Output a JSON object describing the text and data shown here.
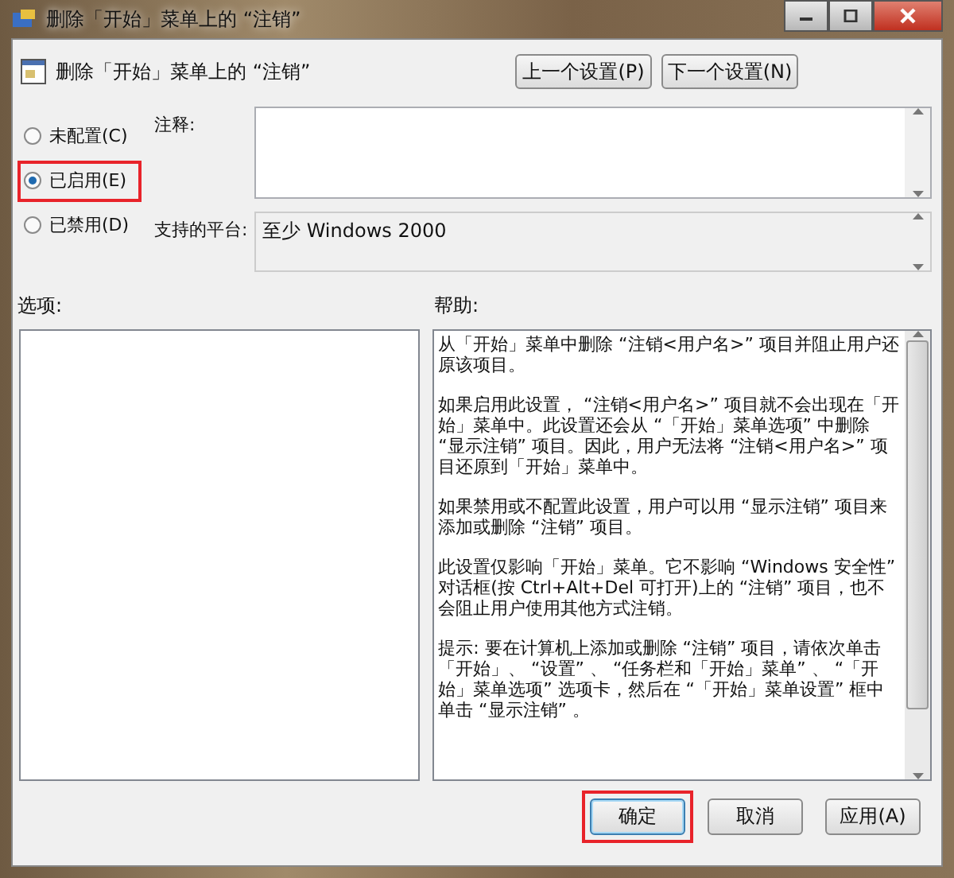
{
  "window": {
    "title": "删除「开始」菜单上的 “注销”"
  },
  "header": {
    "title": "删除「开始」菜单上的 “注销”",
    "buttons": [
      "上一个设置(P)",
      "下一个设置(N)"
    ]
  },
  "state_options": [
    {
      "label": "未配置(C)",
      "selected": false,
      "annotated": false
    },
    {
      "label": "已启用(E)",
      "selected": true,
      "annotated": true
    },
    {
      "label": "已禁用(D)",
      "selected": false,
      "annotated": false
    }
  ],
  "comment": {
    "label": "注释:"
  },
  "platform": {
    "label": "支持的平台:",
    "value": "至少 Windows 2000"
  },
  "options": {
    "label": "选项:"
  },
  "help": {
    "label": "帮助:",
    "paragraphs": [
      "从「开始」菜单中删除 “注销<用户名>” 项目并阻止用户还原该项目。",
      "如果启用此设置， “注销<用户名>” 项目就不会出现在「开始」菜单中。此设置还会从 “「开始」菜单选项” 中删除 “显示注销” 项目。因此，用户无法将 “注销<用户名>” 项目还原到「开始」菜单中。",
      "如果禁用或不配置此设置，用户可以用 “显示注销” 项目来添加或删除 “注销” 项目。",
      "此设置仅影响「开始」菜单。它不影响 “Windows 安全性” 对话框(按 Ctrl+Alt+Del 可打开)上的 “注销” 项目，也不会阻止用户使用其他方式注销。",
      "提示: 要在计算机上添加或删除 “注销” 项目，请依次单击「开始」、 “设置” 、 “任务栏和「开始」菜单” 、 “「开始」菜单选项” 选项卡，然后在 “「开始」菜单设置” 框中单击 “显示注销” 。"
    ]
  },
  "footer_buttons": [
    {
      "label": "确定",
      "default": true,
      "annotated": true
    },
    {
      "label": "取消",
      "default": false,
      "annotated": false
    },
    {
      "label": "应用(A)",
      "default": false,
      "annotated": false
    }
  ]
}
